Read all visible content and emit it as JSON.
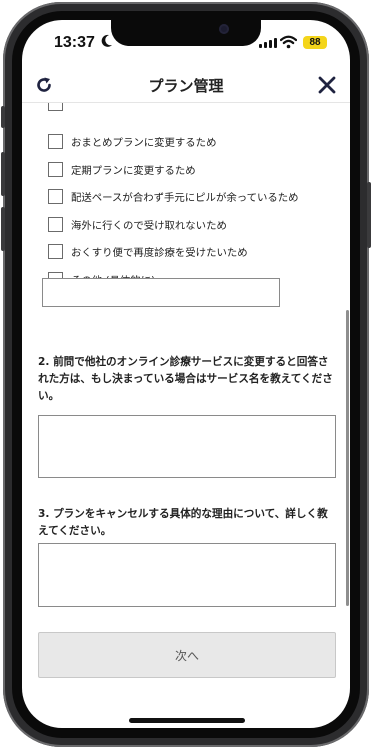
{
  "status_bar": {
    "time": "13:37",
    "battery": "88",
    "icons": [
      "moon-icon",
      "cellular-signal-icon",
      "wifi-icon",
      "battery-icon"
    ]
  },
  "header": {
    "title": "プラン管理",
    "left_icon": "refresh-icon",
    "right_icon": "close-icon"
  },
  "reasons": [
    {
      "label": "",
      "checked": false
    },
    {
      "label": "おまとめプランに変更するため",
      "checked": false
    },
    {
      "label": "定期プランに変更するため",
      "checked": false
    },
    {
      "label": "配送ペースが合わず手元にピルが余っているため",
      "checked": false
    },
    {
      "label": "海外に行くので受け取れないため",
      "checked": false
    },
    {
      "label": "おくすり便で再度診療を受けたいため",
      "checked": false
    },
    {
      "label": "その他 (具体的に)",
      "checked": false
    }
  ],
  "other_input": {
    "value": "",
    "placeholder": ""
  },
  "question2": {
    "text": "2. 前問で他社のオンライン診療サービスに変更すると回答された方は、もし決まっている場合はサービス名を教えてください。",
    "value": ""
  },
  "question3": {
    "text": "3. プランをキャンセルする具体的な理由について、詳しく教えてください。",
    "value": ""
  },
  "next_button": {
    "label": "次へ"
  }
}
